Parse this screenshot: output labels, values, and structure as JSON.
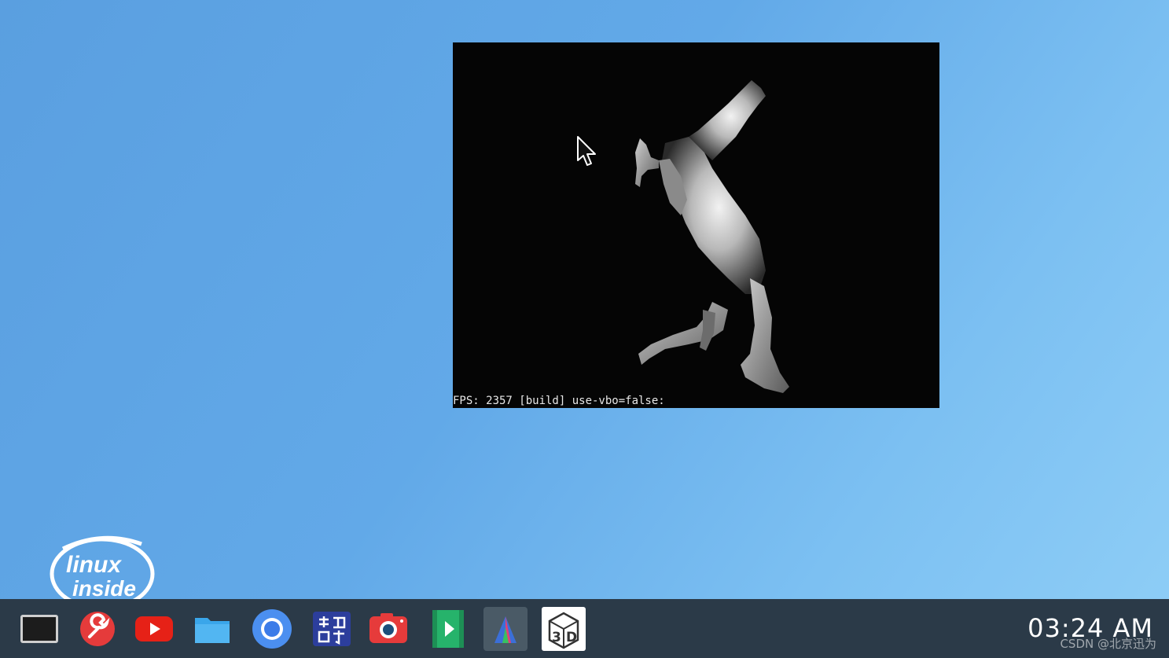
{
  "desktop": {
    "background_color_light": "#8fcef6",
    "background_color_dark": "#5a9fe0"
  },
  "gl_window": {
    "status_text": "FPS: 2357 [build] use-vbo=false:",
    "scene": "horse-model"
  },
  "logo": {
    "line1": "linux",
    "line2": "inside"
  },
  "taskbar": {
    "background": "#2b3a48",
    "apps": [
      {
        "name": "terminal-icon"
      },
      {
        "name": "settings-wrench-icon"
      },
      {
        "name": "youtube-icon"
      },
      {
        "name": "file-manager-icon"
      },
      {
        "name": "chromium-icon"
      },
      {
        "name": "xunwei-electronics-icon"
      },
      {
        "name": "camera-icon"
      },
      {
        "name": "video-player-icon"
      },
      {
        "name": "glmark-triangle-icon"
      },
      {
        "name": "3d-icon"
      }
    ],
    "clock": "03:24 AM"
  },
  "watermark": "CSDN @北京迅为"
}
